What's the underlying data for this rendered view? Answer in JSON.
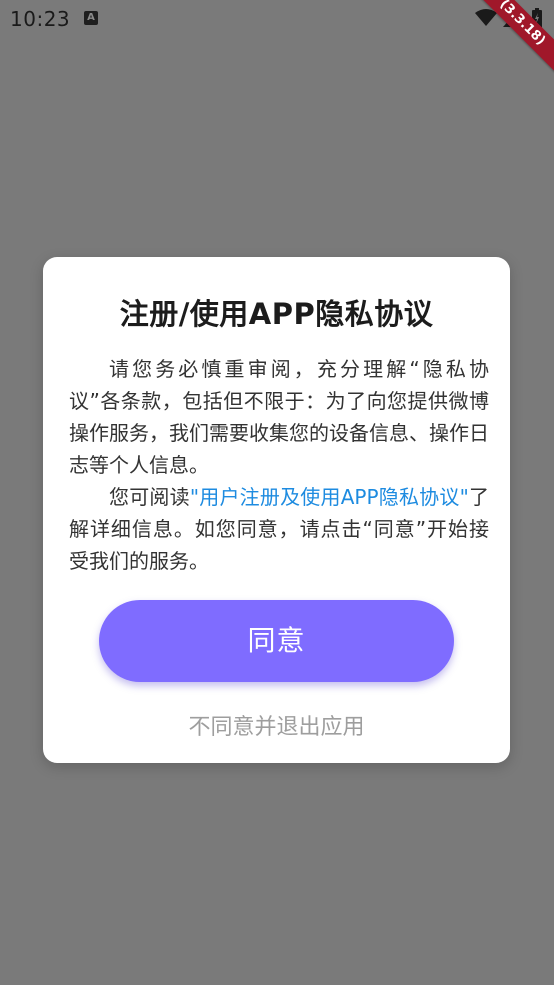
{
  "status_bar": {
    "time": "10:23",
    "notification_badge": "A",
    "icons": [
      "wifi-icon",
      "signal-icon",
      "battery-icon"
    ]
  },
  "debug_banner": {
    "label": "(3.3.18)",
    "color": "#a0182a"
  },
  "dialog": {
    "title": "注册/使用APP隐私协议",
    "paragraph1": "请您务必慎重审阅，充分理解“隐私协议”各条款，包括但不限于：为了向您提供微博操作服务，我们需要收集您的设备信息、操作日志等个人信息。",
    "paragraph2_prefix": "您可阅读",
    "paragraph2_link": "\"用户注册及使用APP隐私协议\"",
    "paragraph2_suffix": "了解详细信息。如您同意，请点击“同意”开始接受我们的服务。",
    "agree_label": "同意",
    "disagree_label": "不同意并退出应用"
  },
  "colors": {
    "overlay": "#7a7a7a",
    "accent": "#7f6cff",
    "link": "#1d8be0",
    "secondary_text": "#9e9e9e"
  }
}
